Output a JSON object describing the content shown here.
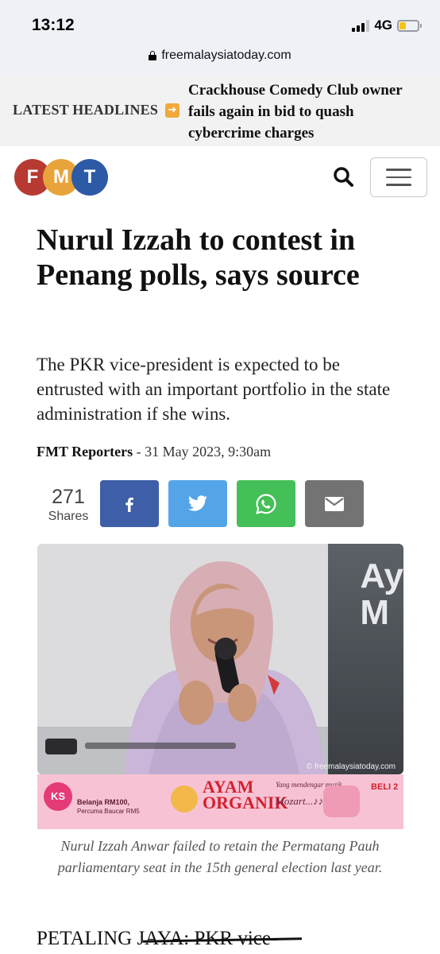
{
  "status_bar": {
    "time": "13:12",
    "network": "4G",
    "battery_icon": "battery-low-icon",
    "battery_color": "#f5c518"
  },
  "browser": {
    "url": "freemalaysiatoday.com",
    "lock_icon": "lock-icon"
  },
  "ticker": {
    "label": "LATEST HEADLINES",
    "arrow_icon": "arrow-right-icon",
    "headline": "Crackhouse Comedy Club owner fails again in bid to quash cybercrime charges"
  },
  "header": {
    "logo_letters": [
      "F",
      "M",
      "T"
    ],
    "logo_colors": [
      "#b73a32",
      "#e8a43a",
      "#2d5aa7"
    ],
    "search_icon": "search-icon",
    "menu_icon": "hamburger-menu-icon"
  },
  "article": {
    "headline": "Nurul Izzah to contest in Penang polls, says source",
    "standfirst": "The PKR vice-president is expected to be entrusted with an important portfolio in the state administration if she wins.",
    "author": "FMT Reporters",
    "date_sep": " - ",
    "date": "31 May 2023, 9:30am",
    "share_count": "271",
    "share_label": "Shares",
    "share_buttons": [
      {
        "name": "facebook",
        "icon": "facebook-icon",
        "color": "#3e5ea8"
      },
      {
        "name": "twitter",
        "icon": "twitter-icon",
        "color": "#54a5e8"
      },
      {
        "name": "whatsapp",
        "icon": "whatsapp-icon",
        "color": "#45bf57"
      },
      {
        "name": "email",
        "icon": "mail-icon",
        "color": "#737373"
      }
    ],
    "photo_backdrop_text": "Ay\nM",
    "photo_credit": "© freemalaysiatoday.com",
    "caption": "Nurul Izzah Anwar failed to retain the Permatang Pauh parliamentary seat in the 15th general election last year.",
    "body_start": "PETALING JAYA: PKR vice-"
  },
  "ad": {
    "ks_logo": "KS",
    "offer_line1": "Belanja RM100,",
    "offer_line2": "Percuma Baucar RM5",
    "brand": "AYAM ORGANIK",
    "tag_line1": "Yang mendengar muzik",
    "tag_line2": "Mozart...♪♪",
    "promo": "BELI 2"
  }
}
